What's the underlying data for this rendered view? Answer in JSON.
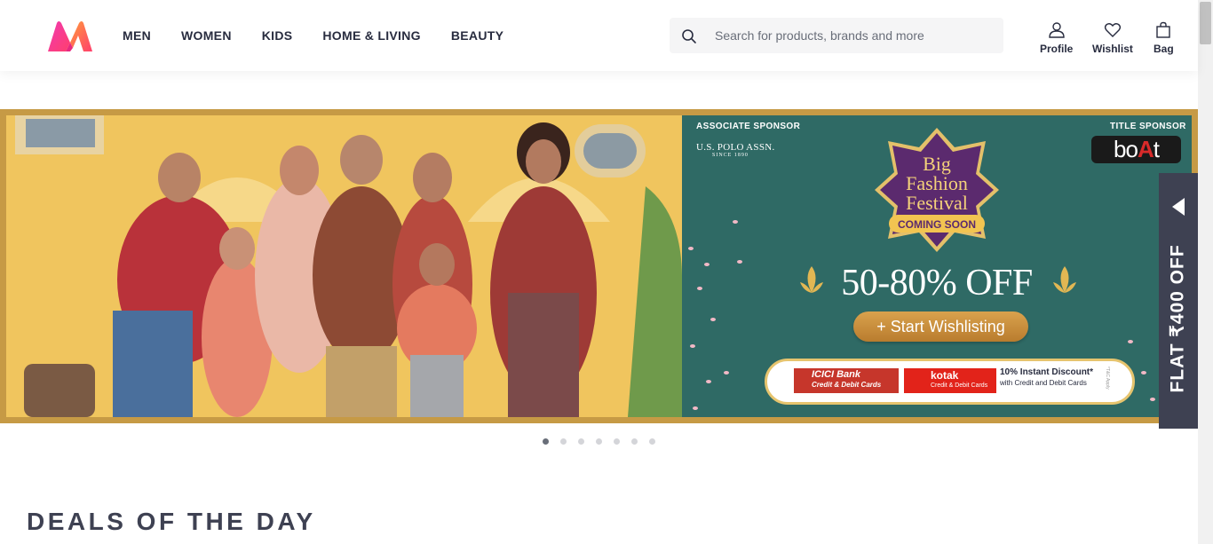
{
  "header": {
    "logo": "myntra-logo",
    "nav": [
      {
        "label": "MEN"
      },
      {
        "label": "WOMEN"
      },
      {
        "label": "KIDS"
      },
      {
        "label": "HOME & LIVING"
      },
      {
        "label": "BEAUTY"
      }
    ],
    "search": {
      "placeholder": "Search for products, brands and more",
      "value": ""
    },
    "actions": [
      {
        "label": "Profile",
        "icon": "profile-icon"
      },
      {
        "label": "Wishlist",
        "icon": "heart-icon"
      },
      {
        "label": "Bag",
        "icon": "bag-icon"
      }
    ]
  },
  "banner": {
    "associate_sponsor_label": "ASSOCIATE SPONSOR",
    "associate_sponsor_name": "U.S. POLO ASSN.",
    "associate_sponsor_since": "SINCE 1890",
    "title_sponsor_label": "TITLE SPONSOR",
    "title_sponsor_name_a": "bo",
    "title_sponsor_name_b": "A",
    "title_sponsor_name_c": "t",
    "festival_line1": "Big",
    "festival_line2": "Fashion",
    "festival_line3": "Festival",
    "festival_status": "COMING SOON",
    "discount": "50-80% OFF",
    "cta": "+ Start Wishlisting",
    "bank1_name": "ICICI Bank",
    "bank1_sub": "Credit & Debit Cards",
    "bank2_name": "kotak",
    "bank2_sub": "Credit & Debit Cards",
    "offer_title": "10% Instant Discount*",
    "offer_sub": "with Credit and Debit Cards",
    "tc": "*T&C Apply"
  },
  "side_tab": {
    "label": "FLAT ₹400 OFF"
  },
  "carousel": {
    "count": 7,
    "active": 1
  },
  "section": {
    "title": "DEALS OF THE DAY"
  },
  "colors": {
    "brand_pink": "#ff3f6c",
    "brand_orange": "#f13ab1",
    "banner_teal": "#2f6a65",
    "gold": "#c69a45",
    "side_tab": "#3e4152"
  }
}
